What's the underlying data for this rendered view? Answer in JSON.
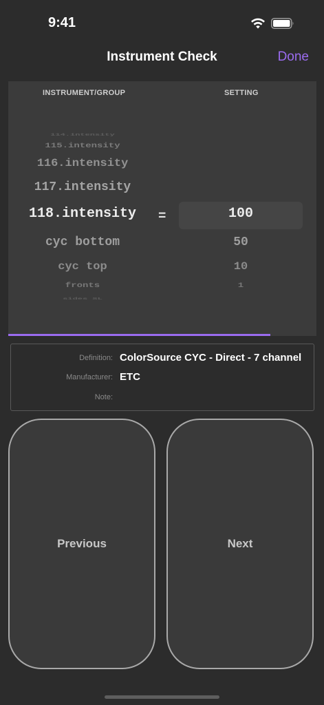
{
  "status_bar": {
    "time": "9:41",
    "icons": [
      "wifi-icon",
      "battery-icon"
    ]
  },
  "nav": {
    "title": "Instrument Check",
    "done_label": "Done",
    "accent_color": "#9b6cf0"
  },
  "picker": {
    "header_instrument": "INSTRUMENT/GROUP",
    "header_setting": "SETTING",
    "equals": "=",
    "rows": [
      {
        "instrument": "114.intensity",
        "setting": ""
      },
      {
        "instrument": "115.intensity",
        "setting": ""
      },
      {
        "instrument": "116.intensity",
        "setting": ""
      },
      {
        "instrument": "117.intensity",
        "setting": ""
      },
      {
        "instrument": "118.intensity",
        "setting": "100"
      },
      {
        "instrument": "cyc bottom",
        "setting": "50"
      },
      {
        "instrument": "cyc top",
        "setting": "10"
      },
      {
        "instrument": "fronts",
        "setting": "1"
      },
      {
        "instrument": "sides SL",
        "setting": ""
      }
    ],
    "selected_index": 4,
    "progress_fraction": 0.85
  },
  "info": {
    "definition_label": "Definition:",
    "definition_value": "ColorSource CYC - Direct - 7 channel",
    "manufacturer_label": "Manufacturer:",
    "manufacturer_value": "ETC",
    "note_label": "Note:",
    "note_value": ""
  },
  "buttons": {
    "previous_label": "Previous",
    "next_label": "Next"
  }
}
